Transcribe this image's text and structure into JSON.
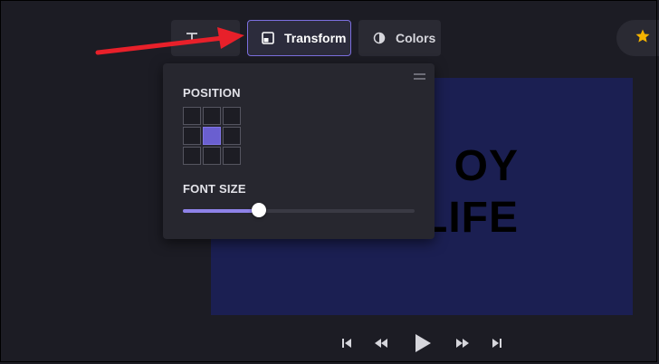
{
  "toolbar": {
    "text_label": "T",
    "transform_label": "Transform",
    "colors_label": "Colors"
  },
  "icons": {
    "text": "text-icon",
    "transform": "layout-square-icon",
    "colors": "contrast-half-icon",
    "favorite": "star-icon"
  },
  "popover": {
    "position_label": "POSITION",
    "font_size_label": "FONT SIZE",
    "position_grid": {
      "rows": 3,
      "cols": 3,
      "selected": [
        1,
        1
      ]
    },
    "font_size_value": 0.33
  },
  "preview": {
    "line1": "OY",
    "line2": "LIFE"
  },
  "player": {
    "controls": [
      "skip-start-icon",
      "rewind-icon",
      "play-icon",
      "fast-forward-icon",
      "skip-end-icon"
    ]
  },
  "colors": {
    "accent": "#7c6fe0",
    "background": "#1c1c24",
    "preview_bg": "#1b1f52",
    "arrow": "#e8202a",
    "star": "#f5b400"
  }
}
